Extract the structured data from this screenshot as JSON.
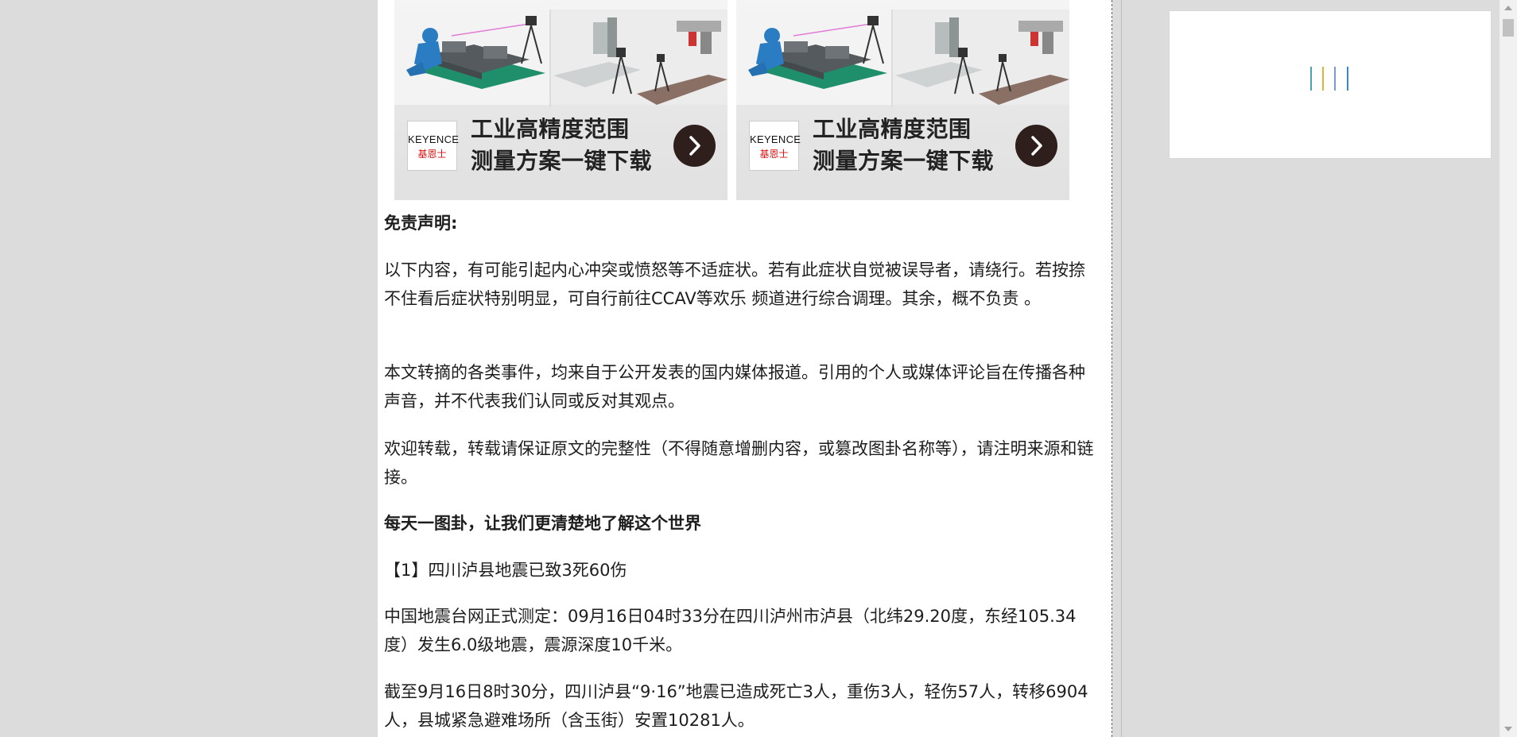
{
  "ads": [
    {
      "logo_top": "KEYENCE",
      "logo_bottom": "基恩士",
      "headline_line1": "工业高精度范围",
      "headline_line2": "测量方案一键下载"
    },
    {
      "logo_top": "KEYENCE",
      "logo_bottom": "基恩士",
      "headline_line1": "工业高精度范围",
      "headline_line2": "测量方案一键下载"
    }
  ],
  "article": {
    "disclaimer_title": "免责声明:",
    "p1": "以下内容，有可能引起内心冲突或愤怒等不适症状。若有此症状自觉被误导者，请绕行。若按捺不住看后症状特别明显，可自行前往CCAV等欢乐 频道进行综合调理。其余，概不负责 。",
    "p2": "本文转摘的各类事件，均来自于公开发表的国内媒体报道。引用的个人或媒体评论旨在传播各种声音，并不代表我们认同或反对其观点。",
    "p3": "欢迎转载，转载请保证原文的完整性（不得随意增删内容，或篡改图卦名称等），请注明来源和链接。",
    "slogan": "每天一图卦，让我们更清楚地了解这个世界",
    "item1_title": "【1】四川泸县地震已致3死60伤",
    "item1_p1": "中国地震台网正式测定：09月16日04时33分在四川泸州市泸县（北纬29.20度，东经105.34度）发生6.0级地震，震源深度10千米。",
    "item1_p2": "截至9月16日8时30分，四川泸县“9·16”地震已造成死亡3人，重伤3人，轻伤57人，转移6904人，县城紧急避难场所（含玉街）安置10281人。"
  },
  "loader_colors": [
    "#4aa3a8",
    "#e0b23c",
    "#7a9bc7",
    "#3a86c8"
  ]
}
